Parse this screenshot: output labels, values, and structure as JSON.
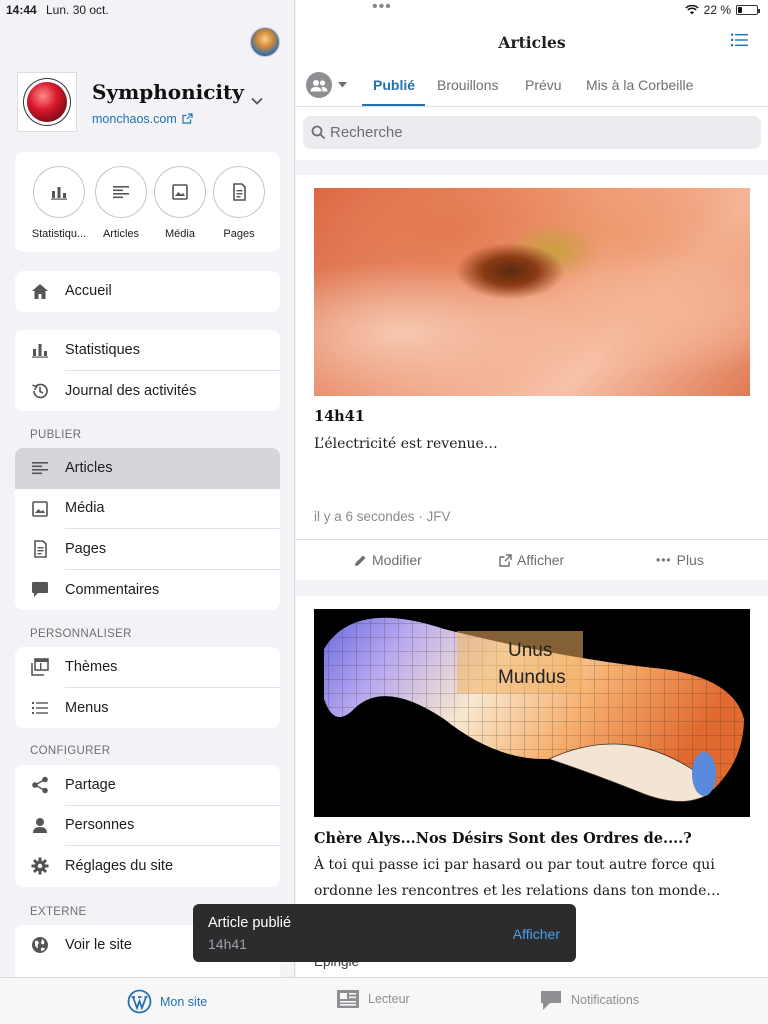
{
  "status_bar": {
    "time": "14:44",
    "date": "Lun. 30 oct.",
    "battery": "22 %",
    "battery_level": 0.22
  },
  "sidebar": {
    "site_name": "Symphonicity",
    "site_url": "monchaos.com",
    "quick_actions": [
      {
        "label": "Statistiqu...",
        "icon": "stats-icon"
      },
      {
        "label": "Articles",
        "icon": "posts-icon"
      },
      {
        "label": "Média",
        "icon": "media-icon"
      },
      {
        "label": "Pages",
        "icon": "pages-icon"
      }
    ],
    "home": {
      "label": "Accueil"
    },
    "stats_group": [
      {
        "label": "Statistiques"
      },
      {
        "label": "Journal des activités"
      }
    ],
    "sections": {
      "publish": "PUBLIER",
      "customize": "PERSONNALISER",
      "configure": "CONFIGURER",
      "external": "EXTERNE"
    },
    "publish_items": [
      {
        "label": "Articles"
      },
      {
        "label": "Média"
      },
      {
        "label": "Pages"
      },
      {
        "label": "Commentaires"
      }
    ],
    "customize_items": [
      {
        "label": "Thèmes"
      },
      {
        "label": "Menus"
      }
    ],
    "configure_items": [
      {
        "label": "Partage"
      },
      {
        "label": "Personnes"
      },
      {
        "label": "Réglages du site"
      }
    ],
    "external_items": [
      {
        "label": "Voir le site"
      }
    ]
  },
  "main": {
    "title": "Articles",
    "tabs": [
      {
        "label": "Publié"
      },
      {
        "label": "Brouillons"
      },
      {
        "label": "Prévu"
      },
      {
        "label": "Mis à la Corbeille"
      }
    ],
    "search_placeholder": "Recherche",
    "posts": [
      {
        "title": "14h41",
        "excerpt": "L’électricité est revenue…",
        "meta": "il y a 6 secondes · JFV",
        "actions": {
          "edit": "Modifier",
          "view": "Afficher",
          "more": "Plus"
        }
      },
      {
        "title": "Chère Alys...Nos Désirs Sont des Ordres de....?",
        "excerpt": "À toi qui passe ici par hasard ou par tout autre force qui ordonne les rencontres et les relations dans ton monde…",
        "meta": "Épinglé",
        "image_text_1": "Unus",
        "image_text_2": "Mundus"
      }
    ]
  },
  "toast": {
    "title": "Article publié",
    "subtitle": "14h41",
    "action": "Afficher"
  },
  "tabbar": [
    {
      "label": "Mon site"
    },
    {
      "label": "Lecteur"
    },
    {
      "label": "Notifications"
    }
  ],
  "colors": {
    "accent": "#2271b1",
    "toast_bg": "#2c2c2e",
    "active_row": "#d6d6da"
  }
}
